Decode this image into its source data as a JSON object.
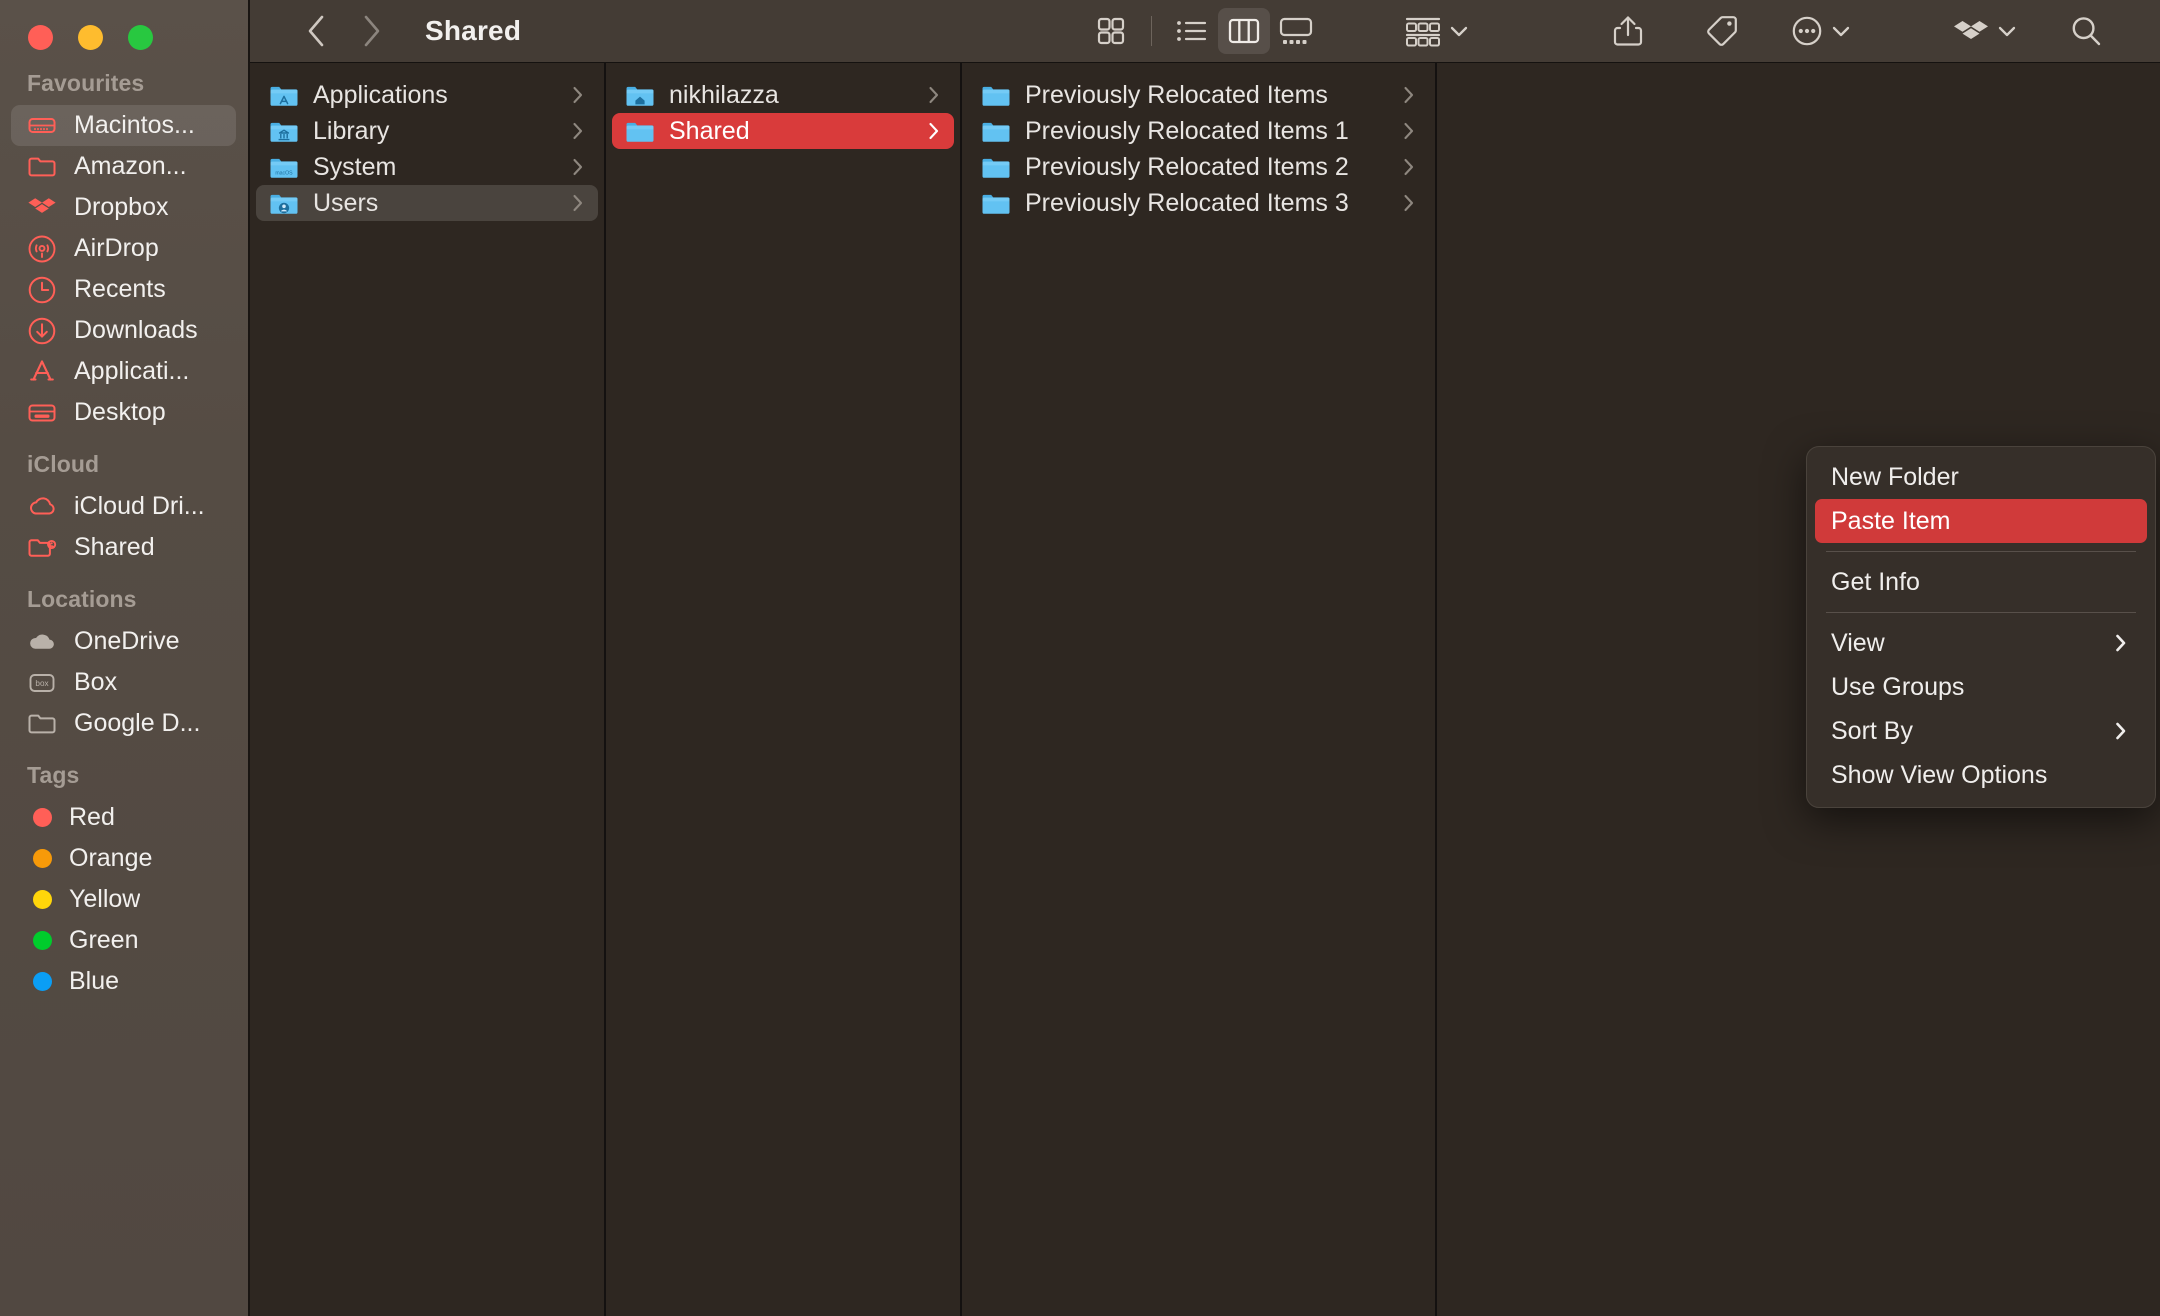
{
  "window": {
    "title": "Shared",
    "traffic_lights": [
      {
        "name": "close",
        "color": "#ff5f57"
      },
      {
        "name": "minimize",
        "color": "#febc2e"
      },
      {
        "name": "zoom",
        "color": "#28c840"
      }
    ]
  },
  "toolbar": {
    "back_icon": "chevron-left-icon",
    "forward_icon": "chevron-right-icon",
    "view_icon_grid": "icon-view-icon",
    "view_icon_list": "list-view-icon",
    "view_icon_column": "column-view-icon",
    "view_icon_gallery": "gallery-view-icon",
    "group_icon": "group-by-icon",
    "share_icon": "share-icon",
    "tag_icon": "tag-icon",
    "more_icon": "more-ellipsis-icon",
    "dropbox_icon": "dropbox-icon",
    "search_icon": "search-icon",
    "active_view": "column"
  },
  "sidebar": {
    "sections": [
      {
        "title": "Favourites",
        "items": [
          {
            "label": "Macintos...",
            "icon": "hard-drive-icon",
            "selected": true
          },
          {
            "label": "Amazon...",
            "icon": "folder-icon",
            "selected": false
          },
          {
            "label": "Dropbox",
            "icon": "dropbox-icon",
            "selected": false
          },
          {
            "label": "AirDrop",
            "icon": "airdrop-icon",
            "selected": false
          },
          {
            "label": "Recents",
            "icon": "clock-icon",
            "selected": false
          },
          {
            "label": "Downloads",
            "icon": "download-icon",
            "selected": false
          },
          {
            "label": "Applicati...",
            "icon": "applications-icon",
            "selected": false
          },
          {
            "label": "Desktop",
            "icon": "desktop-icon",
            "selected": false
          }
        ]
      },
      {
        "title": "iCloud",
        "items": [
          {
            "label": "iCloud Dri...",
            "icon": "cloud-icon",
            "selected": false
          },
          {
            "label": "Shared",
            "icon": "shared-folder-icon",
            "selected": false
          }
        ]
      },
      {
        "title": "Locations",
        "items": [
          {
            "label": "OneDrive",
            "icon": "onedrive-cloud-icon",
            "selected": false
          },
          {
            "label": "Box",
            "icon": "box-icon",
            "selected": false
          },
          {
            "label": "Google D...",
            "icon": "folder-outline-icon",
            "selected": false
          }
        ]
      },
      {
        "title": "Tags",
        "items": [
          {
            "label": "Red",
            "icon": "tag-dot-icon",
            "color": "#ff5f57",
            "selected": false
          },
          {
            "label": "Orange",
            "icon": "tag-dot-icon",
            "color": "#f79a09",
            "selected": false
          },
          {
            "label": "Yellow",
            "icon": "tag-dot-icon",
            "color": "#ffd60a",
            "selected": false
          },
          {
            "label": "Green",
            "icon": "tag-dot-icon",
            "color": "#00cc2c",
            "selected": false
          },
          {
            "label": "Blue",
            "icon": "tag-dot-icon",
            "color": "#0a9ef5",
            "selected": false
          }
        ]
      }
    ]
  },
  "columns": [
    {
      "name": "column-1",
      "items": [
        {
          "label": "Applications",
          "icon": "folder-applications-icon",
          "chevron": true,
          "state": "normal"
        },
        {
          "label": "Library",
          "icon": "folder-library-icon",
          "chevron": true,
          "state": "normal"
        },
        {
          "label": "System",
          "icon": "folder-system-icon",
          "chevron": true,
          "state": "normal"
        },
        {
          "label": "Users",
          "icon": "folder-users-icon",
          "chevron": true,
          "state": "selected-inactive"
        }
      ]
    },
    {
      "name": "column-2",
      "items": [
        {
          "label": "nikhilazza",
          "icon": "folder-home-icon",
          "chevron": true,
          "state": "normal"
        },
        {
          "label": "Shared",
          "icon": "folder-icon",
          "chevron": true,
          "state": "selected-active"
        }
      ]
    },
    {
      "name": "column-3",
      "items": [
        {
          "label": "Previously Relocated Items",
          "icon": "folder-icon",
          "chevron": true,
          "state": "normal"
        },
        {
          "label": "Previously Relocated Items 1",
          "icon": "folder-icon",
          "chevron": true,
          "state": "normal"
        },
        {
          "label": "Previously Relocated Items 2",
          "icon": "folder-icon",
          "chevron": true,
          "state": "normal"
        },
        {
          "label": "Previously Relocated Items 3",
          "icon": "folder-icon",
          "chevron": true,
          "state": "normal"
        }
      ]
    },
    {
      "name": "column-4",
      "items": []
    }
  ],
  "context_menu": {
    "entries": [
      {
        "label": "New Folder",
        "type": "item",
        "highlighted": false,
        "submenu": false
      },
      {
        "label": "Paste Item",
        "type": "item",
        "highlighted": true,
        "submenu": false
      },
      {
        "type": "separator"
      },
      {
        "label": "Get Info",
        "type": "item",
        "highlighted": false,
        "submenu": false
      },
      {
        "type": "separator"
      },
      {
        "label": "View",
        "type": "item",
        "highlighted": false,
        "submenu": true
      },
      {
        "label": "Use Groups",
        "type": "item",
        "highlighted": false,
        "submenu": false
      },
      {
        "label": "Sort By",
        "type": "item",
        "highlighted": false,
        "submenu": true
      },
      {
        "label": "Show View Options",
        "type": "item",
        "highlighted": false,
        "submenu": false
      }
    ]
  },
  "colors": {
    "accent_red": "#d93b3b",
    "sidebar_bg": "#554c44",
    "content_bg": "#2e2721",
    "toolbar_bg": "#443c35",
    "menu_bg": "#362f29",
    "folder_blue": "#4db8f0"
  }
}
